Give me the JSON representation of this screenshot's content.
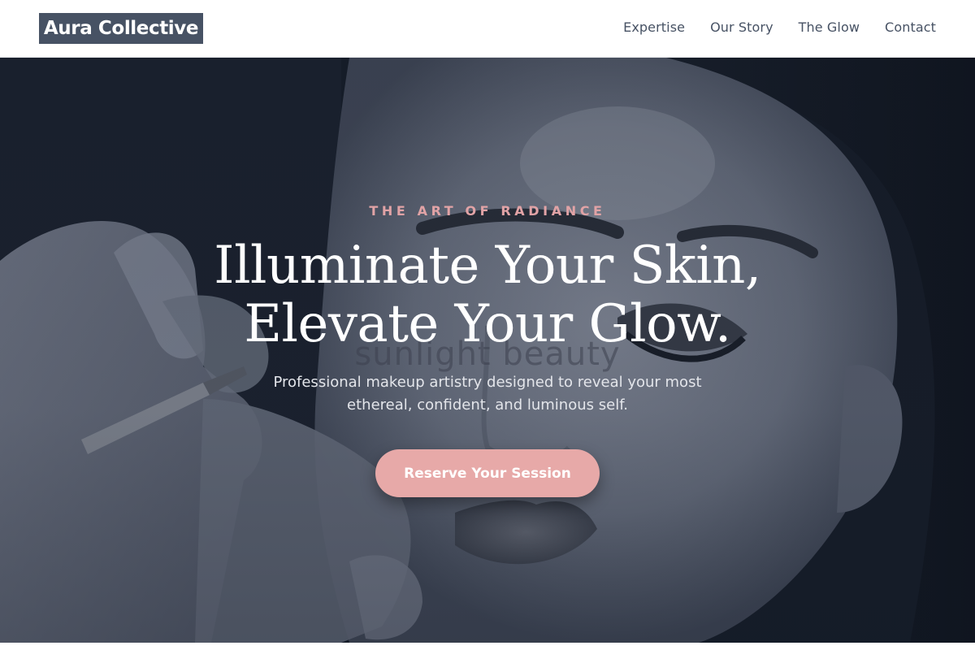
{
  "brand": {
    "logo_text": "Aura Collective"
  },
  "nav": {
    "items": [
      {
        "label": "Expertise"
      },
      {
        "label": "Our Story"
      },
      {
        "label": "The Glow"
      },
      {
        "label": "Contact"
      }
    ]
  },
  "hero": {
    "eyebrow": "THE ART OF RADIANCE",
    "headline_line1": "Illuminate Your Skin,",
    "headline_line2": "Elevate Your Glow.",
    "subtitle": "Professional makeup artistry designed to reveal your most ethereal, confident, and luminous self.",
    "cta_label": "Reserve Your Session",
    "watermark_text": "sunlight beauty",
    "background_image": "makeup-application-photo"
  },
  "colors": {
    "brand_dark": "#475264",
    "accent_pink": "#e7a9a8",
    "eyebrow_pink": "#e1a3a6",
    "hero_base": "#151c28"
  }
}
